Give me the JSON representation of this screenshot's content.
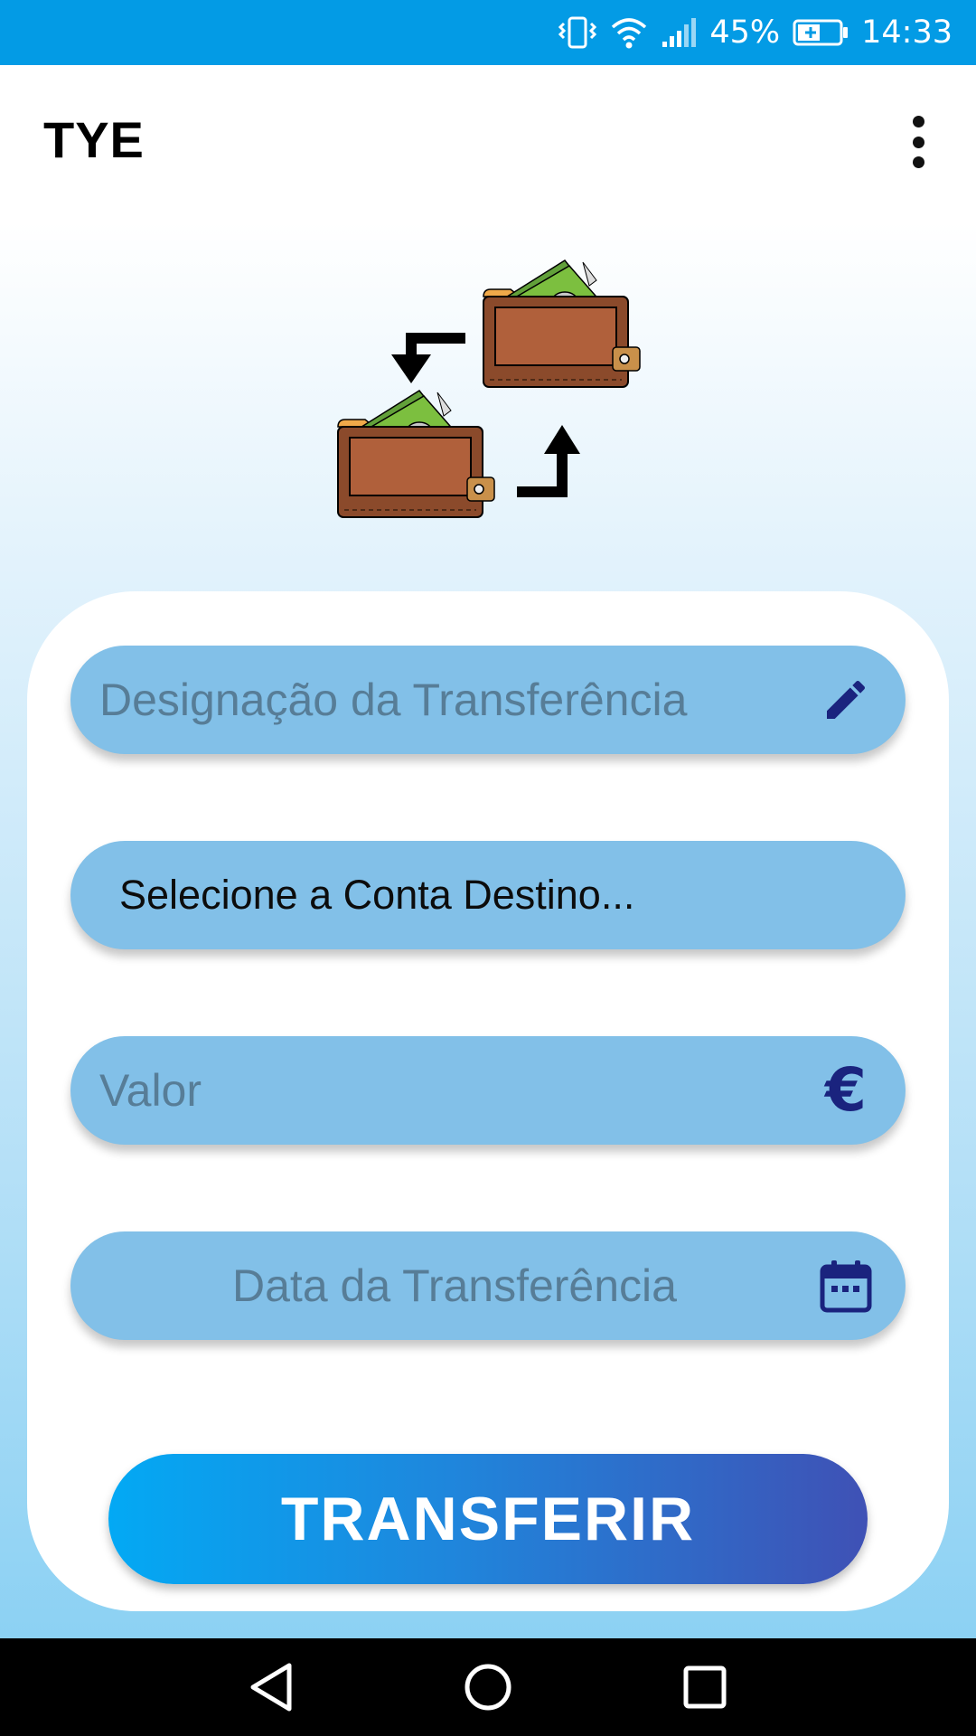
{
  "status_bar": {
    "battery_percent": "45%",
    "time": "14:33",
    "icons": [
      "vibrate-icon",
      "wifi-icon",
      "signal-icon",
      "battery-charging-icon"
    ]
  },
  "app_bar": {
    "title": "TYE",
    "menu_icon": "more-vert-icon"
  },
  "illustration": {
    "icon": "wallet-transfer-icon"
  },
  "form": {
    "designation": {
      "placeholder": "Designação da Transferência",
      "value": "",
      "icon": "pencil-icon"
    },
    "destination_account": {
      "selected": "Selecione a Conta Destino..."
    },
    "amount": {
      "placeholder": "Valor",
      "value": "",
      "icon": "euro-icon",
      "symbol": "€"
    },
    "date": {
      "placeholder": "Data da Transferência",
      "value": "",
      "icon": "calendar-icon"
    },
    "submit_label": "TRANSFERIR"
  },
  "nav_bar": {
    "icons": [
      "back-icon",
      "home-icon",
      "recents-icon"
    ]
  },
  "colors": {
    "status_bar": "#039be5",
    "field_background": "#82c0e8",
    "icon_navy": "#1a237e",
    "button_gradient_start": "#03a9f4",
    "button_gradient_end": "#3f51b5"
  }
}
